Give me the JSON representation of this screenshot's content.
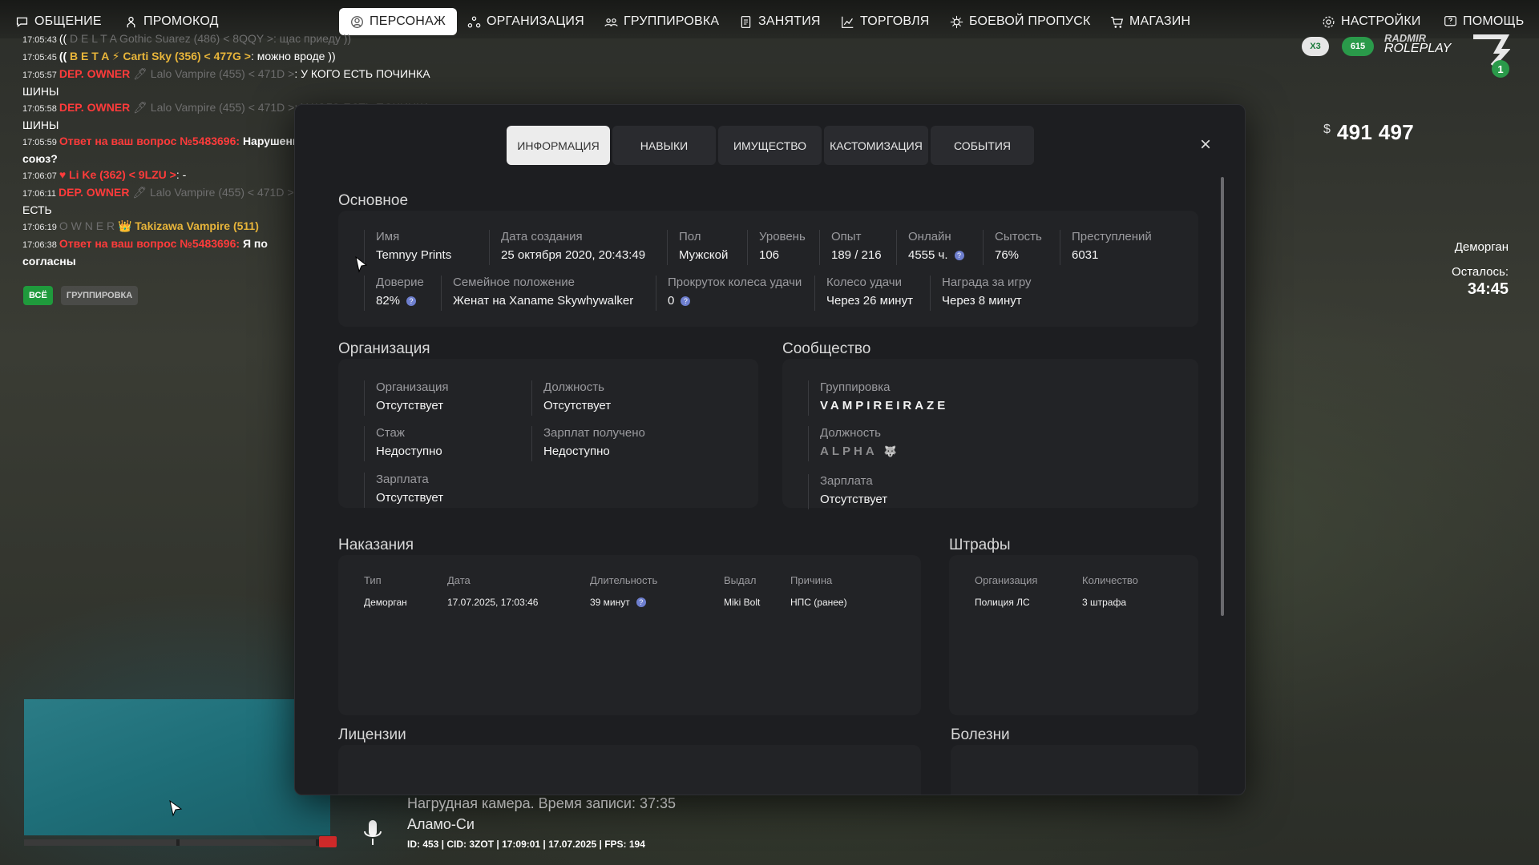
{
  "nav": {
    "left": [
      {
        "icon": "chat-icon",
        "label": "ОБЩЕНИЕ"
      },
      {
        "icon": "promo-icon",
        "label": "ПРОМОКОД"
      },
      {
        "icon": "person-icon",
        "label": "ПЕРСОНАЖ"
      },
      {
        "icon": "organization-icon",
        "label": "ОРГАНИЗАЦИЯ"
      },
      {
        "icon": "group-icon",
        "label": "ГРУППИРОВКА"
      },
      {
        "icon": "tasks-icon",
        "label": "ЗАНЯТИЯ"
      },
      {
        "icon": "trade-icon",
        "label": "ТОРГОВЛЯ"
      },
      {
        "icon": "battlepass-icon",
        "label": "БОЕВОЙ ПРОПУСК"
      },
      {
        "icon": "cart-icon",
        "label": "МАГАЗИН"
      }
    ],
    "right": [
      {
        "icon": "settings-icon",
        "label": "НАСТРОЙКИ"
      },
      {
        "icon": "help-icon",
        "label": "ПОМОЩЬ"
      }
    ],
    "active_index": 2
  },
  "chat": {
    "lines": [
      {
        "ts": "17:05:43",
        "parts": [
          {
            "t": "(( ",
            "c": ""
          },
          {
            "t": "D E L T A",
            "c": "dim"
          },
          {
            "t": " Gothic Suarez (486) < 8QQY >: щас приеду ))",
            "c": "dim"
          }
        ]
      },
      {
        "ts": "17:05:45",
        "parts": [
          {
            "t": "(( ",
            "c": "bold"
          },
          {
            "t": "B E T A ⚡ Carti Sky (356) < 477G >",
            "c": "gold"
          },
          {
            "t": ": можно вроде ))",
            "c": ""
          }
        ]
      },
      {
        "ts": "17:05:57",
        "parts": [
          {
            "t": "DEP. OWNER ",
            "c": "red"
          },
          {
            "t": "🖊 Lalo Vampire (455) < 471D >",
            "c": "dim"
          },
          {
            "t": ": У КОГО ЕСТЬ ПОЧИНКА",
            "c": ""
          }
        ]
      },
      {
        "ts": "",
        "parts": [
          {
            "t": "ШИНЫ",
            "c": ""
          }
        ]
      },
      {
        "ts": "17:05:58",
        "parts": [
          {
            "t": "DEP. OWNER ",
            "c": "red"
          },
          {
            "t": "🖊 Lalo Vampire (455) < 471D >",
            "c": "dim"
          },
          {
            "t": ": У КОГО ЕСТЬ ПОЧИНКА",
            "c": "dim"
          }
        ]
      },
      {
        "ts": "",
        "parts": [
          {
            "t": "ШИНЫ",
            "c": ""
          }
        ]
      },
      {
        "ts": "17:05:59",
        "parts": [
          {
            "t": "Ответ на ваш вопрос №5483696: ",
            "c": "red"
          },
          {
            "t": "Нарушение",
            "c": "bold"
          }
        ]
      },
      {
        "ts": "",
        "parts": [
          {
            "t": "союз?",
            "c": "bold"
          }
        ]
      },
      {
        "ts": "17:06:07",
        "parts": [
          {
            "t": "♥ Li Ke (362) < 9LZU >",
            "c": "red"
          },
          {
            "t": ": -",
            "c": ""
          }
        ]
      },
      {
        "ts": "17:06:11",
        "parts": [
          {
            "t": "DEP. OWNER ",
            "c": "red"
          },
          {
            "t": "🖊 Lalo Vampire (455) < 471D >",
            "c": "dim"
          }
        ]
      },
      {
        "ts": "",
        "parts": [
          {
            "t": "ЕСТЬ",
            "c": ""
          }
        ]
      },
      {
        "ts": "17:06:19",
        "parts": [
          {
            "t": "O W N E R ",
            "c": "dim"
          },
          {
            "t": "👑 Takizawa Vampire (511)",
            "c": "gold"
          }
        ]
      },
      {
        "ts": "17:06:38",
        "parts": [
          {
            "t": "Ответ на ваш вопрос №5483696: ",
            "c": "red"
          },
          {
            "t": "Я по",
            "c": "bold"
          }
        ]
      },
      {
        "ts": "",
        "parts": [
          {
            "t": "согласны",
            "c": "bold"
          }
        ]
      }
    ],
    "filters": [
      "ВСЁ",
      "ГРУППИРОВКА"
    ]
  },
  "hud": {
    "currency": "$",
    "money": "491 497",
    "logo_line1": "RADMIR",
    "logo_line2": "ROLEPLAY",
    "badge_x": "X3",
    "badge_num": "615",
    "jail_label": "Деморган",
    "remaining_label": "Осталось:",
    "remaining_time": "34:45",
    "status_camera": "Нагрудная камера. Время записи: 37:35",
    "status_location": "Аламо-Си",
    "status_meta": "ID: 453 | CID: 3ZOT | 17:09:01 | 17.07.2025 | FPS: 194"
  },
  "modal": {
    "tabs": [
      "ИНФОРМАЦИЯ",
      "НАВЫКИ",
      "ИМУЩЕСТВО",
      "КАСТОМИЗАЦИЯ",
      "СОБЫТИЯ"
    ],
    "active_tab": 0,
    "close": "×",
    "basic": {
      "title": "Основное",
      "row1": [
        {
          "label": "Имя",
          "value": "Temnyy Prints"
        },
        {
          "label": "Дата создания",
          "value": "25 октября 2020, 20:43:49"
        },
        {
          "label": "Пол",
          "value": "Мужской"
        },
        {
          "label": "Уровень",
          "value": "106"
        },
        {
          "label": "Опыт",
          "value": "189 / 216"
        },
        {
          "label": "Онлайн",
          "value": "4555 ч."
        },
        {
          "label": "Сытость",
          "value": "76%"
        },
        {
          "label": "Преступлений",
          "value": "6031"
        }
      ],
      "row2": [
        {
          "label": "Доверие",
          "value": "82%"
        },
        {
          "label": "Семейное положение",
          "value": "Женат на Xaname Skywhywalker"
        },
        {
          "label": "Прокруток колеса удачи",
          "value": "0"
        },
        {
          "label": "Колесо удачи",
          "value": "Через 26 минут"
        },
        {
          "label": "Награда за игру",
          "value": "Через 8 минут"
        }
      ]
    },
    "org": {
      "title": "Организация",
      "fields": [
        {
          "label": "Организация",
          "value": "Отсутствует"
        },
        {
          "label": "Должность",
          "value": "Отсутствует"
        },
        {
          "label": "Стаж",
          "value": "Недоступно"
        },
        {
          "label": "Зарплат получено",
          "value": "Недоступно"
        },
        {
          "label": "Зарплата",
          "value": "Отсутствует"
        }
      ]
    },
    "community": {
      "title": "Сообщество",
      "fields": [
        {
          "label": "Группировка",
          "value": "VAMPIREIRAZE"
        },
        {
          "label": "Должность",
          "value": "ALPHA"
        },
        {
          "label": "Зарплата",
          "value": "Отсутствует"
        }
      ]
    },
    "punishments": {
      "title": "Наказания",
      "headers": [
        "Тип",
        "Дата",
        "Длительность",
        "Выдал",
        "Причина"
      ],
      "rows": [
        [
          "Деморган",
          "17.07.2025, 17:03:46",
          "39 минут",
          "Miki Bolt",
          "НПС (ранее)"
        ]
      ]
    },
    "fines": {
      "title": "Штрафы",
      "headers": [
        "Организация",
        "Количество"
      ],
      "rows": [
        [
          "Полиция ЛС",
          "3 штрафа"
        ]
      ]
    },
    "licenses": {
      "title": "Лицензии"
    },
    "diseases": {
      "title": "Болезни"
    }
  }
}
